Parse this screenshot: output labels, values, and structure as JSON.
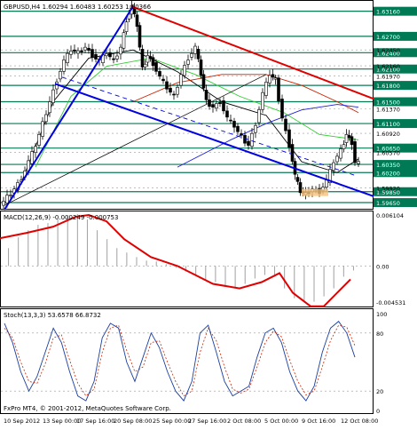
{
  "chart_data": [
    {
      "type": "candlestick",
      "title": "GBPUSD,H4  1.60294 1.60483 1.60253 1.60366",
      "ylim": [
        1.5952,
        1.6335
      ],
      "price_scale_labels": [
        "1.63160",
        "1.62700",
        "1.62400",
        "1.62100",
        "1.61800",
        "1.61500",
        "1.61100",
        "1.60650",
        "1.60350",
        "1.60200",
        "1.59850",
        "1.59650",
        "1.62450",
        "1.62160",
        "1.61970",
        "1.61370",
        "1.60920",
        "1.60570",
        "1.59920"
      ],
      "horizontal_levels": [
        1.6316,
        1.627,
        1.624,
        1.621,
        1.618,
        1.615,
        1.611,
        1.6065,
        1.6035,
        1.602,
        1.5985,
        1.5965
      ],
      "green_levels": [
        1.6316,
        1.627,
        1.624,
        1.621,
        1.618,
        1.615,
        1.611,
        1.6065,
        1.6035,
        1.602,
        1.5985,
        1.5965
      ],
      "close_path": [
        [
          0,
          1.596
        ],
        [
          8,
          1.5975
        ],
        [
          16,
          1.599
        ],
        [
          24,
          1.601
        ],
        [
          32,
          1.604
        ],
        [
          40,
          1.607
        ],
        [
          48,
          1.611
        ],
        [
          56,
          1.615
        ],
        [
          64,
          1.619
        ],
        [
          72,
          1.6225
        ],
        [
          80,
          1.6245
        ],
        [
          88,
          1.624
        ],
        [
          96,
          1.625
        ],
        [
          104,
          1.6235
        ],
        [
          112,
          1.6225
        ],
        [
          120,
          1.624
        ],
        [
          128,
          1.6225
        ],
        [
          136,
          1.625
        ],
        [
          142,
          1.63
        ],
        [
          148,
          1.6325
        ],
        [
          154,
          1.629
        ],
        [
          160,
          1.621
        ],
        [
          166,
          1.6235
        ],
        [
          172,
          1.622
        ],
        [
          180,
          1.6195
        ],
        [
          188,
          1.6175
        ],
        [
          196,
          1.616
        ],
        [
          204,
          1.62
        ],
        [
          212,
          1.623
        ],
        [
          220,
          1.625
        ],
        [
          226,
          1.62
        ],
        [
          232,
          1.615
        ],
        [
          240,
          1.614
        ],
        [
          248,
          1.615
        ],
        [
          256,
          1.612
        ],
        [
          264,
          1.6105
        ],
        [
          272,
          1.6085
        ],
        [
          280,
          1.607
        ],
        [
          288,
          1.611
        ],
        [
          296,
          1.6165
        ],
        [
          304,
          1.62
        ],
        [
          310,
          1.619
        ],
        [
          318,
          1.612
        ],
        [
          326,
          1.607
        ],
        [
          332,
          1.6015
        ],
        [
          338,
          1.5985
        ],
        [
          344,
          1.598
        ],
        [
          352,
          1.599
        ],
        [
          360,
          1.5985
        ],
        [
          368,
          1.6005
        ],
        [
          376,
          1.604
        ],
        [
          384,
          1.606
        ],
        [
          390,
          1.609
        ],
        [
          396,
          1.6075
        ],
        [
          400,
          1.604
        ],
        [
          404,
          1.6037
        ]
      ],
      "trend_lines": [
        {
          "name": "resistance",
          "color": "#e10000",
          "from": [
            148,
            1.6325
          ],
          "to": [
            470,
            1.6125
          ]
        },
        {
          "name": "channel-lower",
          "color": "#0000e0",
          "from": [
            62,
            1.6183
          ],
          "to": [
            450,
            1.596
          ]
        },
        {
          "name": "uptrend",
          "color": "#0000e0",
          "from": [
            5,
            1.5952
          ],
          "to": [
            150,
            1.6325
          ]
        }
      ],
      "moving_averages": [
        {
          "name": "ma-fast",
          "color": "#000000",
          "points": [
            [
              20,
              1.5985
            ],
            [
              60,
              1.615
            ],
            [
              100,
              1.623
            ],
            [
              150,
              1.6245
            ],
            [
              200,
              1.6205
            ],
            [
              250,
              1.615
            ],
            [
              300,
              1.6125
            ],
            [
              340,
              1.604
            ],
            [
              380,
              1.602
            ],
            [
              404,
              1.6045
            ]
          ]
        },
        {
          "name": "ma-green",
          "color": "#33cc33",
          "points": [
            [
              40,
              1.603
            ],
            [
              80,
              1.616
            ],
            [
              120,
              1.6215
            ],
            [
              170,
              1.623
            ],
            [
              220,
              1.62
            ],
            [
              270,
              1.616
            ],
            [
              320,
              1.613
            ],
            [
              360,
              1.609
            ],
            [
              404,
              1.608
            ]
          ]
        },
        {
          "name": "ma-red",
          "color": "#cc2200",
          "points": [
            [
              150,
              1.615
            ],
            [
              200,
              1.6185
            ],
            [
              250,
              1.62
            ],
            [
              300,
              1.62
            ],
            [
              340,
              1.618
            ],
            [
              380,
              1.615
            ],
            [
              404,
              1.613
            ]
          ]
        },
        {
          "name": "ma-blue",
          "color": "#1f1fd6",
          "points": [
            [
              200,
              1.603
            ],
            [
              260,
              1.608
            ],
            [
              300,
              1.611
            ],
            [
              340,
              1.6135
            ],
            [
              380,
              1.6145
            ],
            [
              404,
              1.614
            ]
          ]
        }
      ]
    },
    {
      "type": "histogram",
      "title": "MACD(12,26,9) -0.000249 -0.000753",
      "ylim": [
        -0.00453,
        0.0061
      ],
      "axis_labels": [
        "0.006104",
        "0.00",
        "-0.004531"
      ],
      "signal_line": [
        [
          0,
          0.0031
        ],
        [
          30,
          0.0037
        ],
        [
          60,
          0.0044
        ],
        [
          85,
          0.0055
        ],
        [
          100,
          0.0057
        ],
        [
          120,
          0.005
        ],
        [
          140,
          0.003
        ],
        [
          170,
          0.001
        ],
        [
          200,
          0.0
        ],
        [
          240,
          -0.002
        ],
        [
          270,
          -0.0025
        ],
        [
          295,
          -0.0018
        ],
        [
          315,
          -0.0008
        ],
        [
          330,
          -0.003
        ],
        [
          350,
          -0.0045
        ],
        [
          365,
          -0.0045
        ],
        [
          380,
          -0.003
        ],
        [
          395,
          -0.0015
        ]
      ],
      "histogram_bars": [
        0.002,
        0.0032,
        0.004,
        0.0046,
        0.0048,
        0.0052,
        0.0056,
        0.0058,
        0.0052,
        0.004,
        0.003,
        0.002,
        0.0015,
        0.001,
        0.0006,
        0.0005,
        0.0002,
        -0.0002,
        -0.0006,
        -0.001,
        -0.0015,
        -0.0018,
        -0.0022,
        -0.0024,
        -0.002,
        -0.0014,
        -0.001,
        -0.0012,
        -0.0025,
        -0.0036,
        -0.0041,
        -0.004,
        -0.0034,
        -0.0025,
        -0.0012,
        -0.0005
      ]
    },
    {
      "type": "line",
      "title": "Stoch(13,3,3) 53.6578 66.8732",
      "ylim": [
        0,
        100
      ],
      "axis_labels": [
        "100",
        "80",
        "20",
        "0"
      ],
      "series": [
        {
          "name": "main",
          "color": "#1a3fa0",
          "values": [
            90,
            70,
            40,
            20,
            35,
            60,
            85,
            70,
            40,
            15,
            10,
            30,
            75,
            90,
            85,
            50,
            30,
            55,
            80,
            65,
            40,
            20,
            10,
            30,
            80,
            88,
            60,
            30,
            15,
            20,
            25,
            55,
            80,
            85,
            70,
            40,
            20,
            10,
            25,
            60,
            85,
            92,
            80,
            55
          ]
        },
        {
          "name": "signal",
          "color": "#cc2200",
          "values": [
            85,
            75,
            50,
            30,
            28,
            48,
            75,
            78,
            52,
            28,
            15,
            22,
            60,
            85,
            88,
            62,
            40,
            45,
            70,
            72,
            50,
            30,
            15,
            20,
            60,
            85,
            72,
            45,
            22,
            18,
            22,
            45,
            70,
            82,
            76,
            52,
            30,
            16,
            20,
            45,
            72,
            88,
            86,
            67
          ]
        }
      ]
    }
  ],
  "time_axis": [
    "10 Sep 2012",
    "13 Sep 00:00",
    "17 Sep 16:00",
    "20 Sep 08:00",
    "25 Sep 00:00",
    "27 Sep 16:00",
    "2 Oct 08:00",
    "5 Oct 00:00",
    "9 Oct 16:00",
    "12 Oct 08:00"
  ],
  "footer": {
    "copyright": "FxPro MT4, © 2001-2012, MetaQuotes Software Corp."
  },
  "colors": {
    "green": "#008f6a",
    "panel_bg": "#ffffff",
    "axis_bg": "#ffffff",
    "price_box": "#007a55"
  }
}
